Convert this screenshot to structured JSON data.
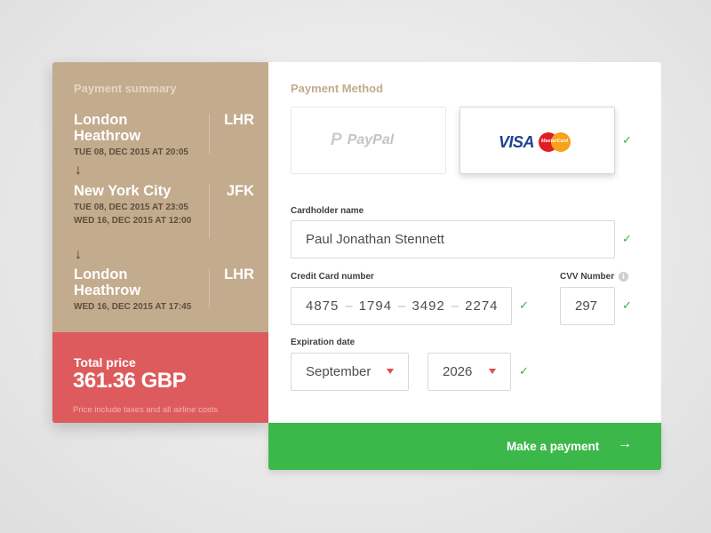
{
  "summary": {
    "title": "Payment summary",
    "stops": [
      {
        "city": "London Heathrow",
        "code": "LHR",
        "times": [
          "TUE 08, DEC 2015 AT 20:05"
        ]
      },
      {
        "city": "New York City",
        "code": "JFK",
        "times": [
          "TUE 08, DEC 2015 AT 23:05",
          "WED 16, DEC 2015 AT 12:00"
        ]
      },
      {
        "city": "London Heathrow",
        "code": "LHR",
        "times": [
          "WED 16, DEC 2015 AT 17:45"
        ]
      }
    ],
    "arrow_icon": "arrow-down-icon",
    "total": {
      "label": "Total price",
      "value": "361.36 GBP",
      "note": "Price include taxes and all airline costs"
    }
  },
  "payment": {
    "title": "Payment Method",
    "methods": [
      {
        "name": "PayPal",
        "label": "PayPal",
        "selected": false
      },
      {
        "name": "Visa / Mastercard",
        "visa": "VISA",
        "mastercard": "MasterCard",
        "selected": true
      }
    ],
    "cardholder": {
      "label": "Cardholder name",
      "value": "Paul Jonathan Stennett",
      "valid": true
    },
    "card_number": {
      "label": "Credit Card number",
      "groups": [
        "4875",
        "1794",
        "3492",
        "2274"
      ],
      "separator": "–",
      "valid": true
    },
    "cvv": {
      "label": "CVV Number",
      "value": "297",
      "info_icon": "i",
      "valid": true
    },
    "expiration": {
      "label": "Expiration date",
      "month": "September",
      "year": "2026",
      "valid": true
    }
  },
  "check_icon": "✓",
  "submit": {
    "label": "Make a payment",
    "arrow": "→"
  },
  "colors": {
    "summary_bg": "#c3ab8e",
    "total_bg": "#de5b5d",
    "accent_green": "#3cb84a",
    "check_green": "#2fb34a",
    "caret_red": "#e04a4d"
  }
}
